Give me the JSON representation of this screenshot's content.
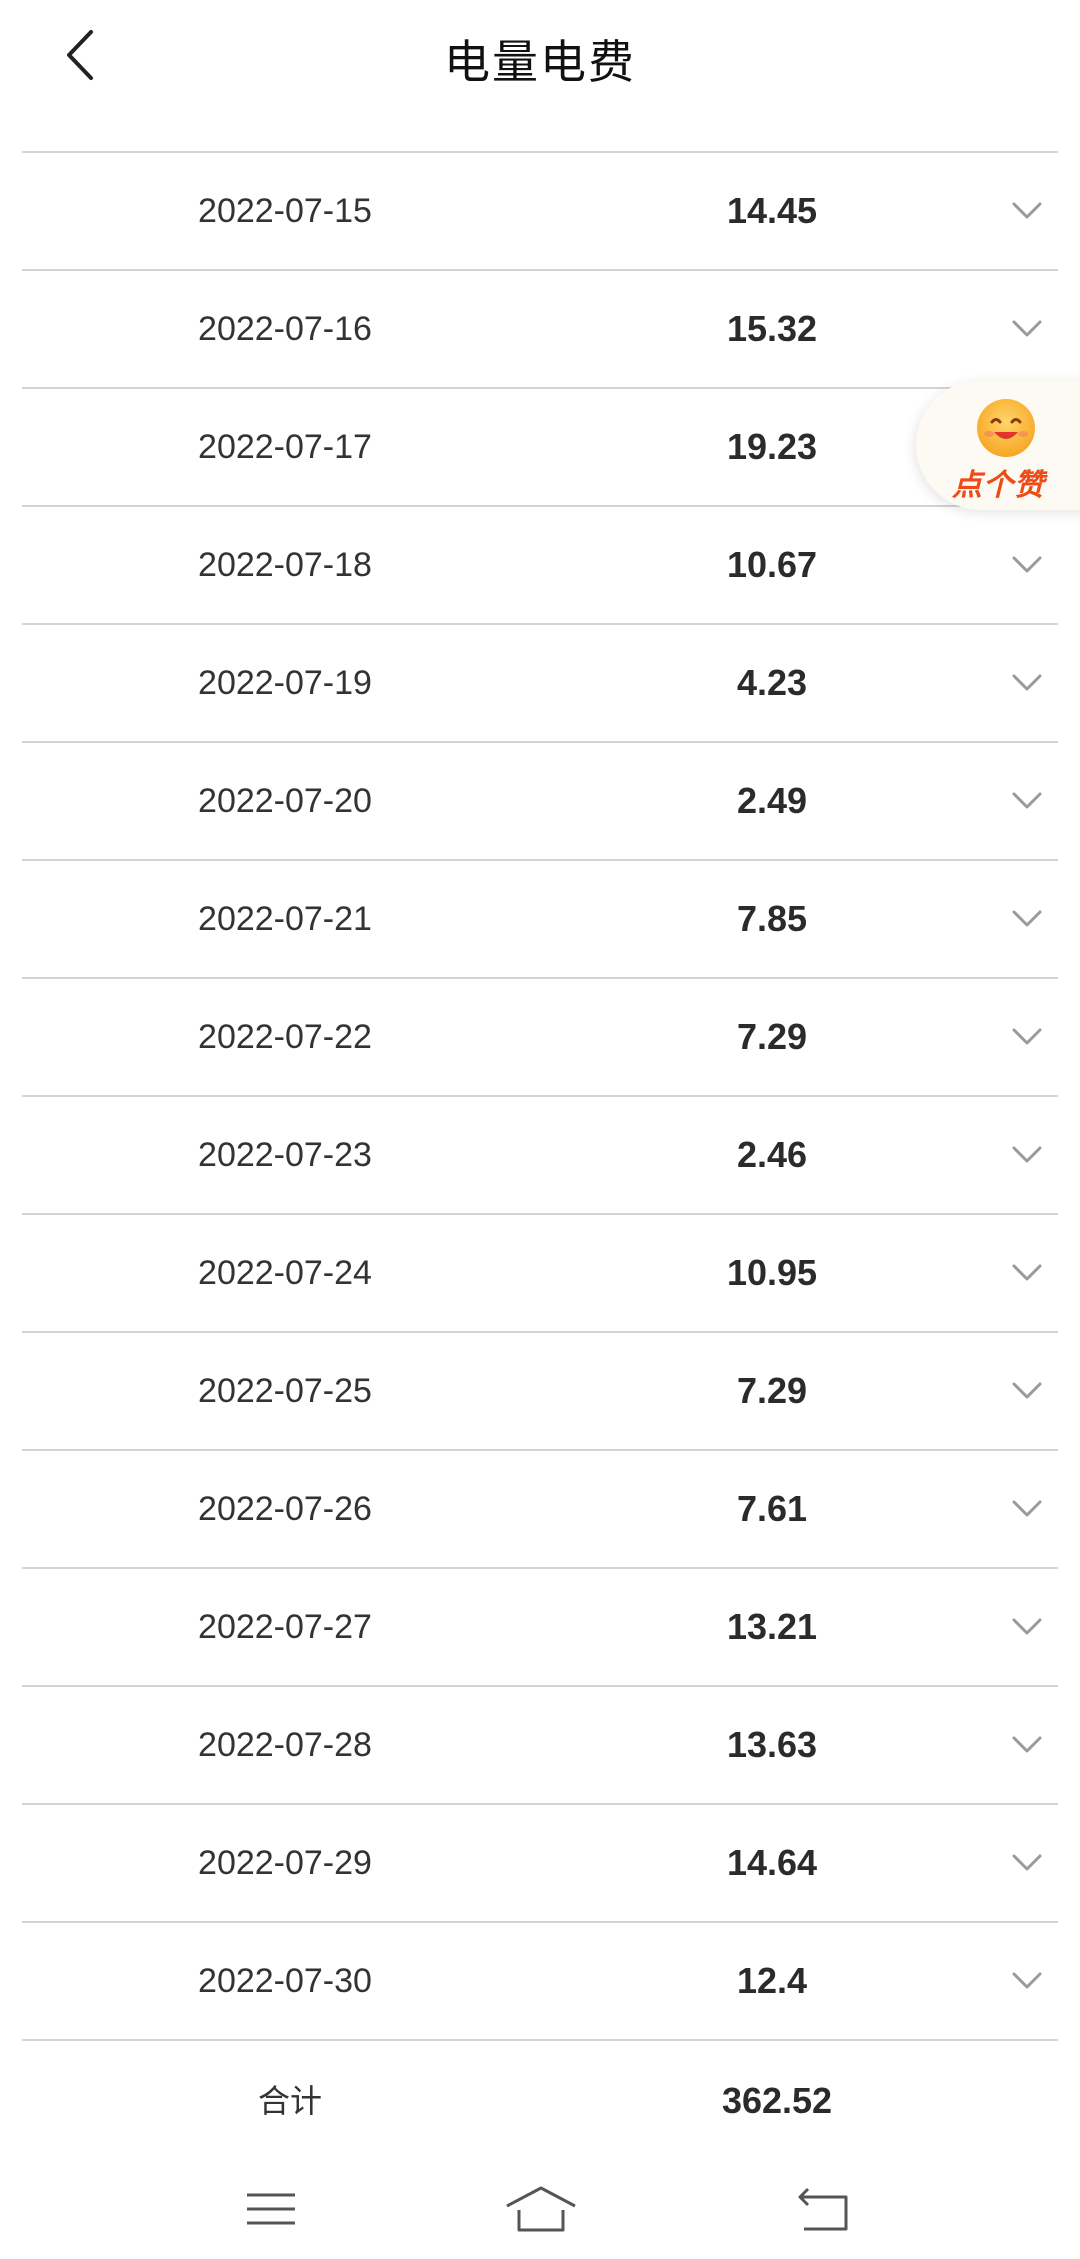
{
  "header": {
    "title": "电量电费",
    "back_icon": "chevron-left-icon"
  },
  "rows": [
    {
      "date": "2022-07-15",
      "amount": "14.45"
    },
    {
      "date": "2022-07-16",
      "amount": "15.32"
    },
    {
      "date": "2022-07-17",
      "amount": "19.23"
    },
    {
      "date": "2022-07-18",
      "amount": "10.67"
    },
    {
      "date": "2022-07-19",
      "amount": "4.23"
    },
    {
      "date": "2022-07-20",
      "amount": "2.49"
    },
    {
      "date": "2022-07-21",
      "amount": "7.85"
    },
    {
      "date": "2022-07-22",
      "amount": "7.29"
    },
    {
      "date": "2022-07-23",
      "amount": "2.46"
    },
    {
      "date": "2022-07-24",
      "amount": "10.95"
    },
    {
      "date": "2022-07-25",
      "amount": "7.29"
    },
    {
      "date": "2022-07-26",
      "amount": "7.61"
    },
    {
      "date": "2022-07-27",
      "amount": "13.21"
    },
    {
      "date": "2022-07-28",
      "amount": "13.63"
    },
    {
      "date": "2022-07-29",
      "amount": "14.64"
    },
    {
      "date": "2022-07-30",
      "amount": "12.4"
    }
  ],
  "total": {
    "label": "合计",
    "value": "362.52"
  },
  "like_button": {
    "label": "点个赞",
    "icon": "smiley-face-icon",
    "accent_color": "#ee4b16"
  },
  "navbar": {
    "icons": [
      "menu-icon",
      "home-icon",
      "back-icon"
    ]
  },
  "colors": {
    "divider": "#d4d4d4",
    "text": "#2b2b2b",
    "chevron": "#9a9a9a"
  }
}
